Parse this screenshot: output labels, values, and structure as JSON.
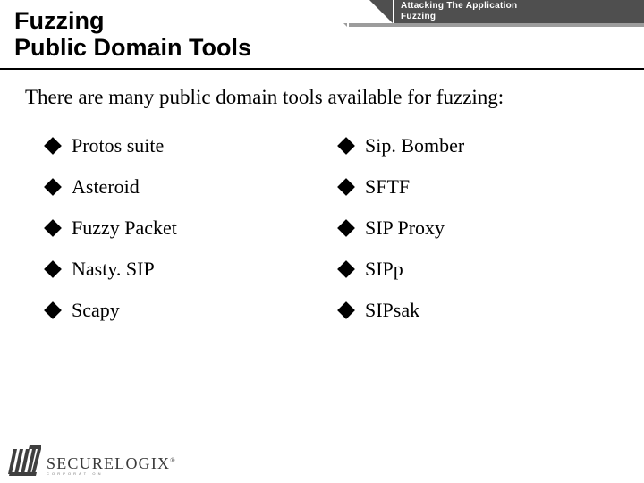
{
  "breadcrumb": {
    "line1": "Attacking The Application",
    "line2": "Fuzzing"
  },
  "title": {
    "line1": "Fuzzing",
    "line2": "Public Domain Tools"
  },
  "intro": "There are many public domain tools available for fuzzing:",
  "tools": {
    "left": [
      "Protos suite",
      "Asteroid",
      "Fuzzy Packet",
      "Nasty. SIP",
      "Scapy"
    ],
    "right": [
      "Sip. Bomber",
      "SFTF",
      "SIP Proxy",
      "SIPp",
      "SIPsak"
    ]
  },
  "footer": {
    "brand_first": "S",
    "brand_rest": "ECURE",
    "brand_second_first": "L",
    "brand_second_rest": "OGIX",
    "registered": "®",
    "subline": "CORPORATION"
  }
}
